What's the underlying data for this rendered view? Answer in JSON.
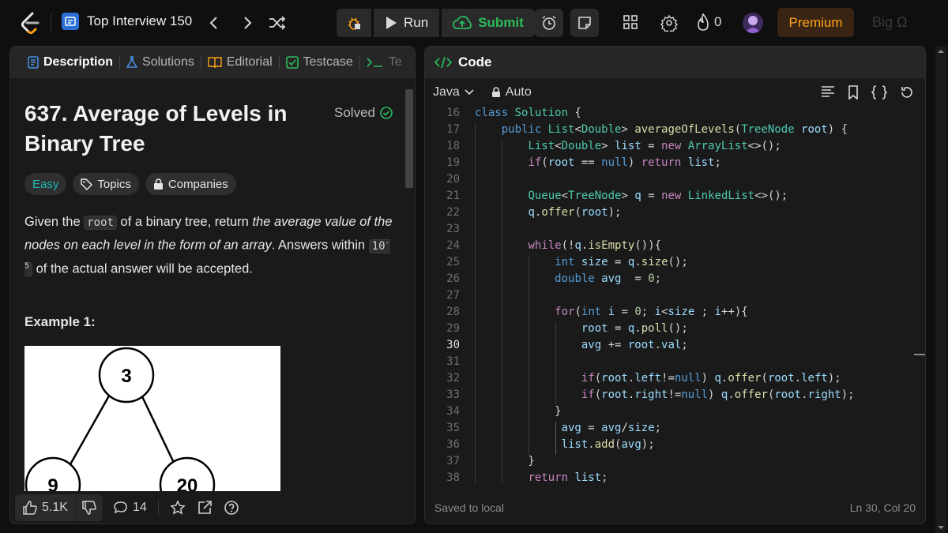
{
  "topbar": {
    "problem_list": "Top Interview 150",
    "run_label": "Run",
    "submit_label": "Submit",
    "points": "0",
    "premium_label": "Premium",
    "bigo_label": "Big Ω"
  },
  "left": {
    "tabs": [
      "Description",
      "Solutions",
      "Editorial",
      "Testcase",
      "Te"
    ],
    "title": "637. Average of Levels in Binary Tree",
    "solved_label": "Solved",
    "chips": [
      "Easy",
      "Topics",
      "Companies"
    ],
    "desc_p1_a": "Given the ",
    "desc_code": "root",
    "desc_p1_b": " of a binary tree, return ",
    "desc_p1_em": "the average value of the nodes on each level in the form of an array",
    "desc_p1_c": ". Answers within ",
    "desc_exp_base": "10",
    "desc_exp_sup": "-5",
    "desc_p1_d": " of the actual answer will be accepted.",
    "example_label": "Example 1:",
    "tree_nodes": [
      "3",
      "9",
      "20"
    ],
    "likes": "5.1K",
    "comments": "14"
  },
  "right": {
    "header": "Code",
    "language": "Java",
    "mode": "Auto",
    "saved": "Saved to local",
    "cursor": "Ln 30, Col 20",
    "line_numbers": [
      "16",
      "17",
      "18",
      "19",
      "20",
      "21",
      "22",
      "23",
      "24",
      "25",
      "26",
      "27",
      "28",
      "29",
      "30",
      "31",
      "32",
      "33",
      "34",
      "35",
      "36",
      "37",
      "38"
    ]
  },
  "colors": {
    "accent_green": "#2cbb5d",
    "premium_orange": "#ffa116",
    "easy_teal": "#1cb8b8"
  }
}
